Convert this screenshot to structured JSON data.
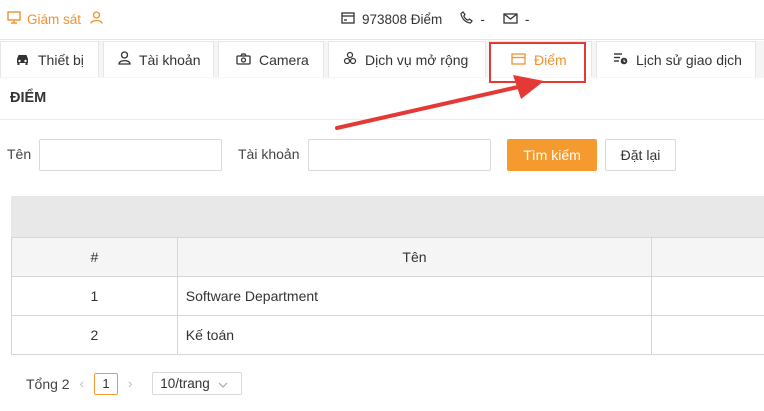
{
  "topbar": {
    "brand_label": "Giám sát",
    "points_label": "973808 Điểm",
    "phone_label": "-",
    "email_label": "-"
  },
  "tabs": [
    {
      "label": "Thiết bị",
      "icon": "car-icon"
    },
    {
      "label": "Tài khoản",
      "icon": "user-icon"
    },
    {
      "label": "Camera",
      "icon": "camera-icon"
    },
    {
      "label": "Dịch vụ mở rộng",
      "icon": "extension-icon"
    },
    {
      "label": "Điểm",
      "icon": "card-icon",
      "active": true
    },
    {
      "label": "Lịch sử giao dịch",
      "icon": "history-icon"
    }
  ],
  "section": {
    "title": "ĐIỂM"
  },
  "search": {
    "name_label": "Tên",
    "name_value": "",
    "account_label": "Tài khoản",
    "account_value": "",
    "search_button": "Tìm kiếm",
    "reset_button": "Đặt lại"
  },
  "table": {
    "columns": [
      "#",
      "Tên",
      ""
    ],
    "rows": [
      {
        "index": "1",
        "name": "Software Department"
      },
      {
        "index": "2",
        "name": "Kế toán"
      }
    ]
  },
  "pagination": {
    "total_label": "Tổng 2",
    "current_page": "1",
    "page_size_label": "10/trang"
  },
  "colors": {
    "accent": "#f59a2f",
    "highlight": "#e53935"
  }
}
